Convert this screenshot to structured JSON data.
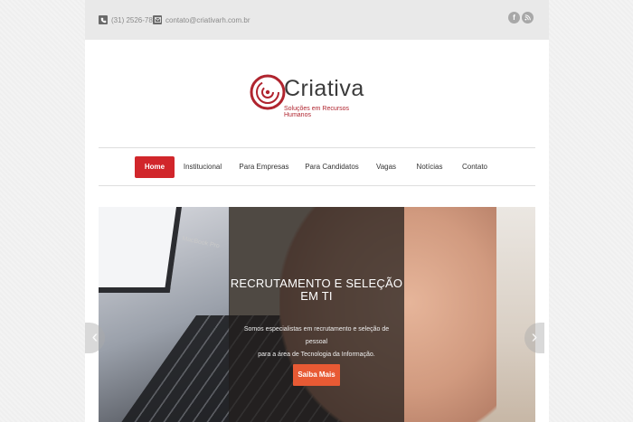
{
  "header": {
    "phone": "(31) 2526-7820",
    "email": "contato@criativarh.com.br",
    "social": [
      {
        "name": "facebook",
        "glyph": "f"
      },
      {
        "name": "rss",
        "glyph": "⊘"
      }
    ]
  },
  "logo": {
    "name": "Criativa",
    "tagline": "Soluções em Recursos Humanos",
    "accent": "#b0242e"
  },
  "nav": {
    "items": [
      {
        "label": "Home",
        "active": true
      },
      {
        "label": "Institucional"
      },
      {
        "label": "Para Empresas"
      },
      {
        "label": "Para Candidatos"
      },
      {
        "label": "Vagas"
      },
      {
        "label": "Notícias"
      },
      {
        "label": "Contato"
      }
    ],
    "active_color": "#d1262b"
  },
  "slider": {
    "title_line1": "RECRUTAMENTO E SELEÇÃO",
    "title_line2": "EM TI",
    "text_line1": "Somos especialistas em recrutamento e seleção de pessoal",
    "text_line2": "para a área de Tecnologia da Informação.",
    "button": "Saiba Mais",
    "button_color": "#e85a34",
    "laptop_label": "MacBook Pro",
    "prev_glyph": "‹",
    "next_glyph": "›"
  }
}
